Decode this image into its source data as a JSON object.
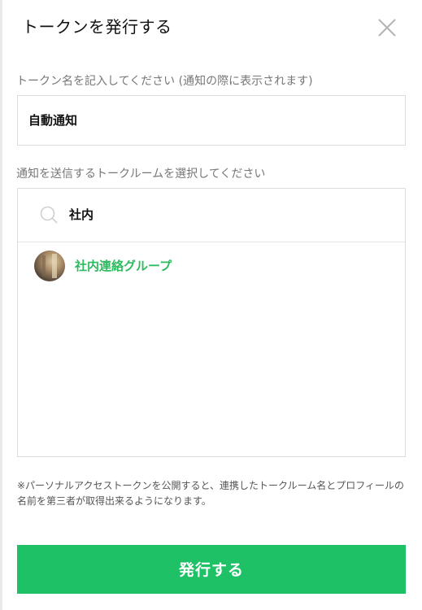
{
  "dialog": {
    "title": "トークンを発行する",
    "close_icon": "close-icon"
  },
  "token_name": {
    "label": "トークン名を記入してください (通知の際に表示されます)",
    "value": "自動通知"
  },
  "room_select": {
    "label": "通知を送信するトークルームを選択してください",
    "search_icon": "search-icon",
    "search_value": "社内",
    "results": [
      {
        "name": "社内連絡グループ"
      }
    ]
  },
  "notice": "※パーソナルアクセストークンを公開すると、連携したトークルーム名とプロフィールの名前を第三者が取得出来るようになります。",
  "submit": {
    "label": "発行する"
  },
  "colors": {
    "accent": "#1ec166",
    "room_name": "#2dbb5f"
  }
}
